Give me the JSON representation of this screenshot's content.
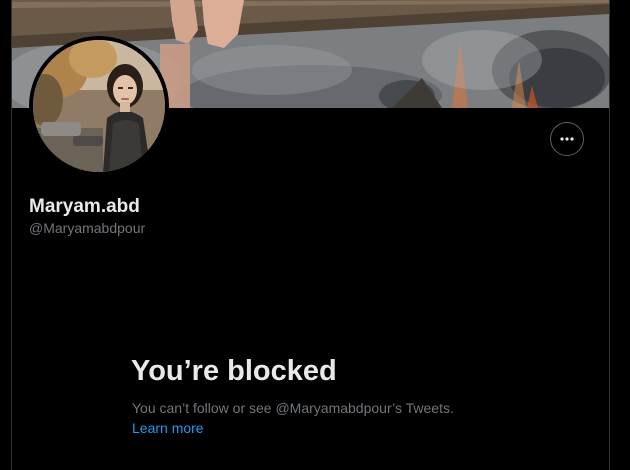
{
  "profile": {
    "display_name": "Maryam.abd",
    "handle": "@Maryamabdpour"
  },
  "icons": {
    "more": "more-horizontal-icon"
  },
  "blocked": {
    "title": "You’re blocked",
    "message": "You can’t follow or see @Maryamabdpour’s Tweets.",
    "learn_more": "Learn more"
  },
  "colors": {
    "background": "#000000",
    "primary_text": "#e7e9ea",
    "secondary_text": "#71767b",
    "link": "#1d9bf0",
    "border": "#2f3336"
  }
}
